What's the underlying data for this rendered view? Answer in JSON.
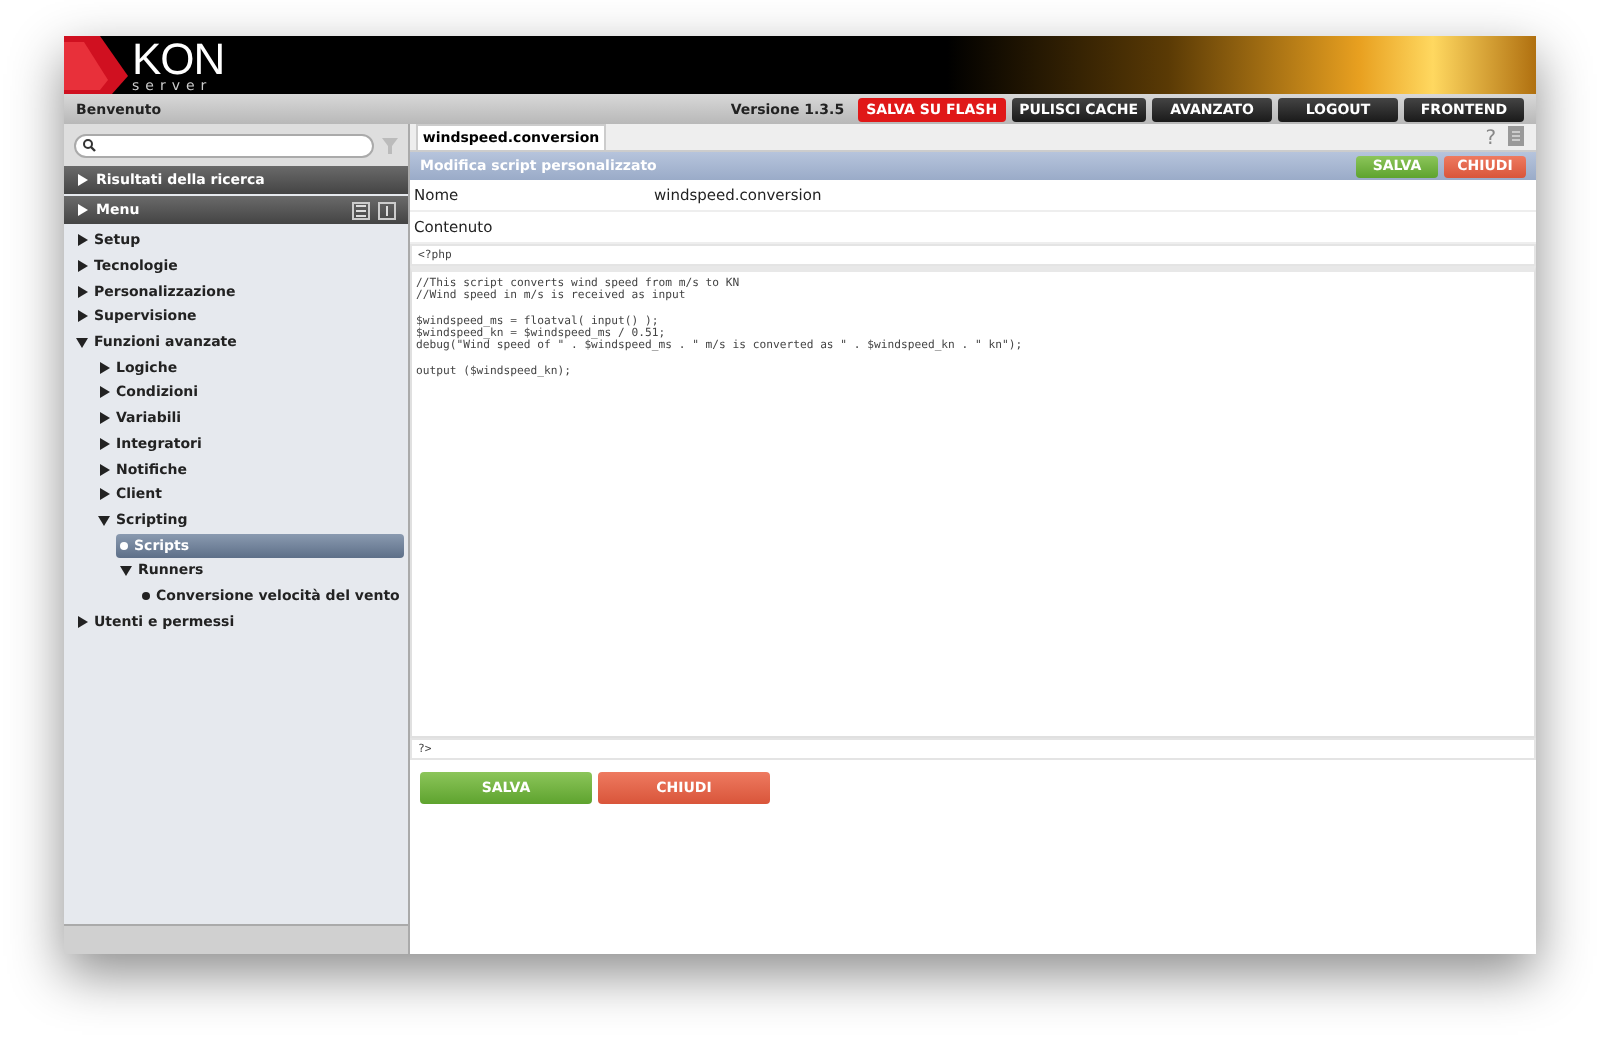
{
  "header": {
    "logo_main": "KON",
    "logo_sub": "server"
  },
  "toolbar": {
    "welcome": "Benvenuto",
    "version": "Versione 1.3.5",
    "buttons": [
      {
        "label": "SALVA SU FLASH",
        "kind": "danger"
      },
      {
        "label": "PULISCI CACHE",
        "kind": "dark"
      },
      {
        "label": "AVANZATO",
        "kind": "dark"
      },
      {
        "label": "LOGOUT",
        "kind": "dark"
      },
      {
        "label": "FRONTEND",
        "kind": "dark"
      }
    ]
  },
  "sidebar": {
    "sections": [
      {
        "label": "Risultati della ricerca",
        "expanded": false
      },
      {
        "label": "Menu",
        "expanded": false
      }
    ],
    "tree": [
      {
        "label": "Setup",
        "kind": "folder",
        "expanded": false,
        "selected": false
      },
      {
        "label": "Tecnologie",
        "kind": "folder",
        "expanded": false,
        "selected": false
      },
      {
        "label": "Personalizzazione",
        "kind": "folder",
        "expanded": false,
        "selected": false
      },
      {
        "label": "Supervisione",
        "kind": "folder",
        "expanded": false,
        "selected": false
      },
      {
        "label": "Funzioni avanzate",
        "kind": "folder",
        "expanded": true,
        "selected": false,
        "children": [
          {
            "label": "Logiche",
            "kind": "folder",
            "expanded": false,
            "selected": false
          },
          {
            "label": "Condizioni",
            "kind": "folder",
            "expanded": false,
            "selected": false
          },
          {
            "label": "Variabili",
            "kind": "folder",
            "expanded": false,
            "selected": false
          },
          {
            "label": "Integratori",
            "kind": "folder",
            "expanded": false,
            "selected": false
          },
          {
            "label": "Notifiche",
            "kind": "folder",
            "expanded": false,
            "selected": false
          },
          {
            "label": "Client",
            "kind": "folder",
            "expanded": false,
            "selected": false
          },
          {
            "label": "Scripting",
            "kind": "folder",
            "expanded": true,
            "selected": false,
            "children": [
              {
                "label": "Scripts",
                "kind": "leaf",
                "selected": true
              },
              {
                "label": "Runners",
                "kind": "folder",
                "expanded": true,
                "selected": false,
                "children": [
                  {
                    "label": "Conversione velocità del vento",
                    "kind": "leaf",
                    "selected": false
                  }
                ]
              }
            ]
          }
        ]
      },
      {
        "label": "Utenti e permessi",
        "kind": "folder",
        "expanded": false,
        "selected": false
      }
    ]
  },
  "tabs": [
    {
      "label": "windspeed.conversion",
      "selected": true
    }
  ],
  "help": "?",
  "panel": {
    "title": "Modifica script personalizzato",
    "buttons": [
      {
        "label": "SALVA",
        "kind": "save"
      },
      {
        "label": "CHIUDI",
        "kind": "close"
      }
    ],
    "fields": [
      {
        "label": "Nome",
        "value": "windspeed.conversion"
      },
      {
        "label": "Contenuto"
      }
    ],
    "code_open": "<?php",
    "code": [
      [
        "//This script converts wind speed from m/s to KN",
        "//Wind speed in m/s is received as input"
      ],
      [
        "$windspeed_ms = floatval( input() );",
        "$windspeed_kn = $windspeed_ms / 0.51;",
        "debug(\"Wind speed of \" . $windspeed_ms . \" m/s is converted as \" . $windspeed_kn . \" kn\");"
      ],
      [
        "output ($windspeed_kn);"
      ]
    ],
    "code_close": "?>",
    "footer_buttons": [
      {
        "label": "SALVA",
        "kind": "save"
      },
      {
        "label": "CHIUDI",
        "kind": "close"
      }
    ]
  }
}
